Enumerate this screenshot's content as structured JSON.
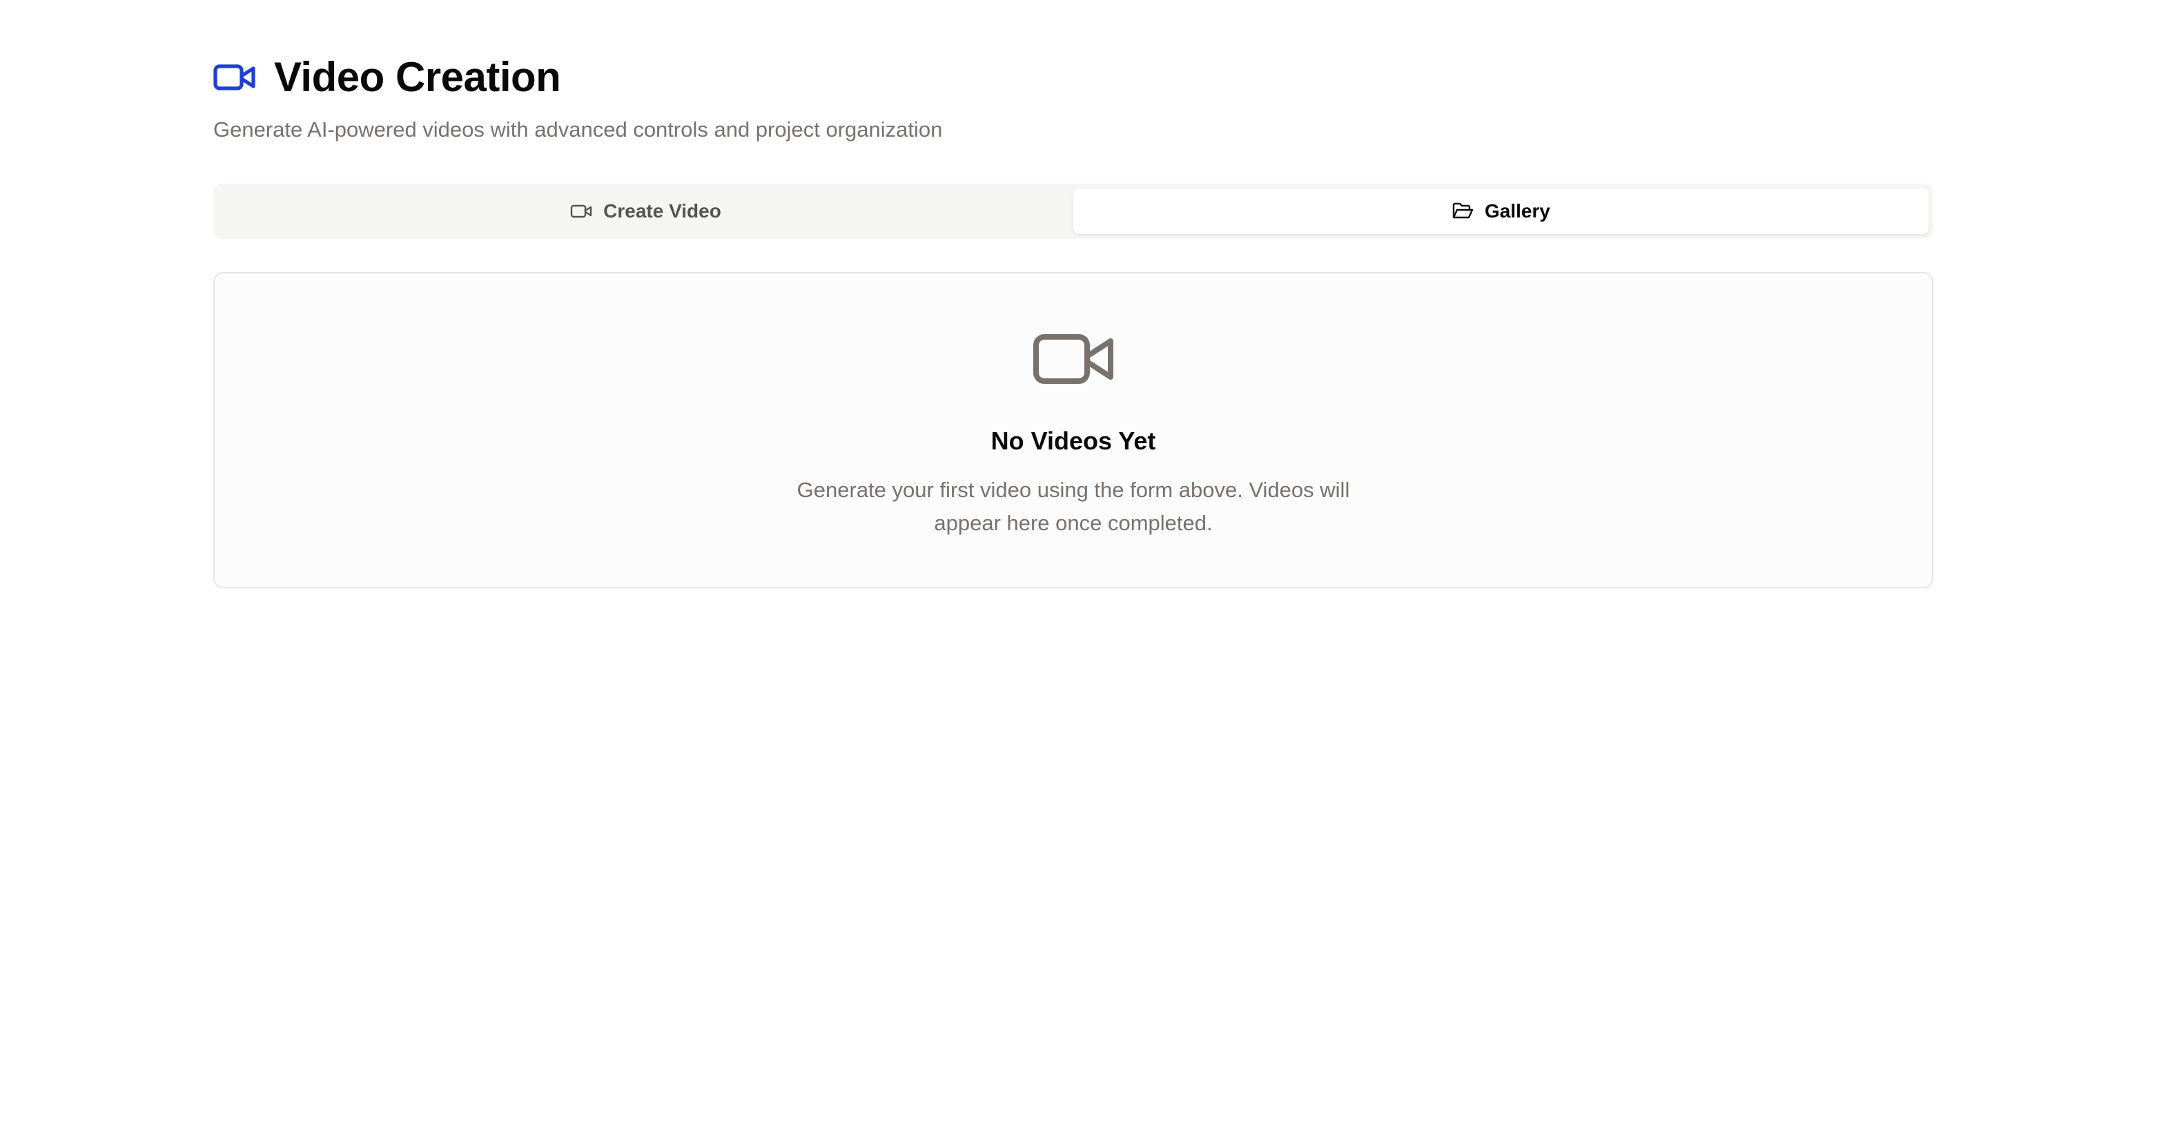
{
  "header": {
    "title": "Video Creation",
    "subtitle": "Generate AI-powered videos with advanced controls and project organization",
    "icon": "video-camera-icon",
    "accent_color": "#1d3fd6"
  },
  "tabs": [
    {
      "label": "Create Video",
      "icon": "video-camera-icon",
      "active": false
    },
    {
      "label": "Gallery",
      "icon": "folder-open-icon",
      "active": true
    }
  ],
  "empty_state": {
    "icon": "video-camera-icon",
    "title": "No Videos Yet",
    "description": "Generate your first video using the form above. Videos will appear here once completed.",
    "icon_color": "#78716c"
  }
}
